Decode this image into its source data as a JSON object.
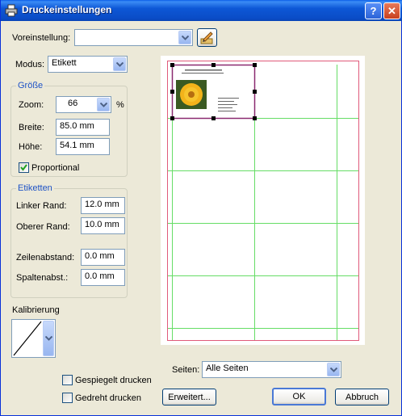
{
  "window": {
    "title": "Druckeinstellungen",
    "help_glyph": "?",
    "close_glyph": "✕"
  },
  "preset": {
    "label": "Voreinstellung:",
    "value": ""
  },
  "mode": {
    "label": "Modus:",
    "value": "Etikett"
  },
  "size_group": {
    "title": "Größe",
    "zoom_label": "Zoom:",
    "zoom_value": "66",
    "zoom_unit": "%",
    "width_label": "Breite:",
    "width_value": "85.0 mm",
    "height_label": "Höhe:",
    "height_value": "54.1 mm",
    "proportional_label": "Proportional",
    "proportional_checked": true
  },
  "labels_group": {
    "title": "Etiketten",
    "left_margin_label": "Linker Rand:",
    "left_margin_value": "12.0 mm",
    "top_margin_label": "Oberer Rand:",
    "top_margin_value": "10.0 mm",
    "row_spacing_label": "Zeilenabstand:",
    "row_spacing_value": "0.0 mm",
    "col_spacing_label": "Spaltenabst.:",
    "col_spacing_value": "0.0 mm"
  },
  "calibration": {
    "label": "Kalibrierung"
  },
  "pages": {
    "label": "Seiten:",
    "value": "Alle Seiten"
  },
  "options": {
    "mirrored_label": "Gespiegelt drucken",
    "mirrored_checked": false,
    "rotated_label": "Gedreht drucken",
    "rotated_checked": false
  },
  "buttons": {
    "advanced": "Erweitert...",
    "ok": "OK",
    "cancel": "Abbruch"
  },
  "colors": {
    "grid": "#66dd66",
    "margin": "#e05a7a",
    "selection": "#8a2a70",
    "titlebar": "#0a4cc6"
  },
  "icons": {
    "app": "printer-icon",
    "edit": "edit-pencil-icon",
    "dropdown": "chevron-down-icon"
  }
}
